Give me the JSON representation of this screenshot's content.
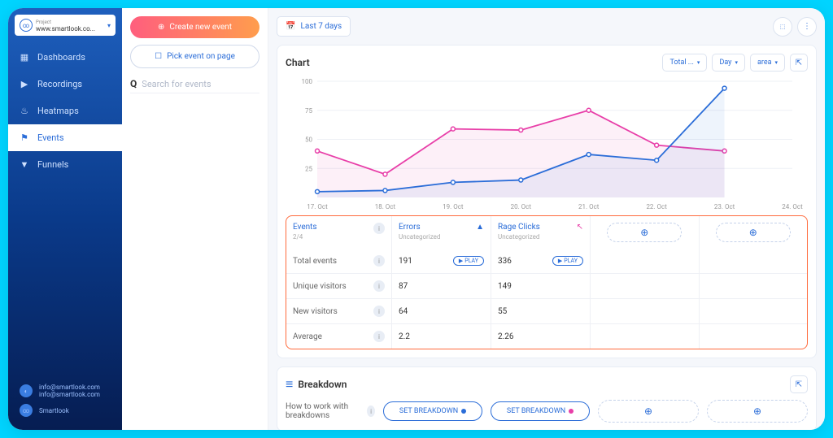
{
  "project": {
    "label": "Project",
    "value": "www.smartlook.co..."
  },
  "nav": [
    {
      "label": "Dashboards"
    },
    {
      "label": "Recordings"
    },
    {
      "label": "Heatmaps"
    },
    {
      "label": "Events"
    },
    {
      "label": "Funnels"
    }
  ],
  "user": {
    "email1": "info@smartlook.com",
    "email2": "info@smartlook.com",
    "brand": "Smartlook"
  },
  "panel2": {
    "create": "Create new event",
    "pick": "Pick event on page",
    "search_ph": "Search for events"
  },
  "topbar": {
    "range": "Last 7 days"
  },
  "chart": {
    "title": "Chart",
    "filters": {
      "metric": "Total ...",
      "granularity": "Day",
      "style": "area"
    }
  },
  "chart_data": {
    "type": "line",
    "x": [
      "17. Oct",
      "18. Oct",
      "19. Oct",
      "20. Oct",
      "21. Oct",
      "22. Oct",
      "23. Oct",
      "24. Oct"
    ],
    "series": [
      {
        "name": "Errors",
        "color": "#e83ea8",
        "values": [
          40,
          20,
          59,
          58,
          75,
          45,
          40,
          null
        ]
      },
      {
        "name": "Rage Clicks",
        "color": "#2b6dd8",
        "values": [
          5,
          6,
          13,
          15,
          37,
          32,
          94,
          null
        ]
      }
    ],
    "ylabel": "",
    "xlabel": "",
    "ylim": [
      0,
      100
    ],
    "yticks": [
      25,
      50,
      75,
      100
    ]
  },
  "stats": {
    "head": {
      "label": "Events",
      "sub": "2/4"
    },
    "cols": [
      {
        "name": "Errors",
        "sub": "Uncategorized",
        "color": "blue"
      },
      {
        "name": "Rage Clicks",
        "sub": "Uncategorized",
        "color": "pink"
      }
    ],
    "rows": [
      {
        "label": "Total events",
        "vals": [
          "191",
          "336"
        ],
        "play": true
      },
      {
        "label": "Unique visitors",
        "vals": [
          "87",
          "149"
        ]
      },
      {
        "label": "New visitors",
        "vals": [
          "64",
          "55"
        ]
      },
      {
        "label": "Average",
        "vals": [
          "2.2",
          "2.26"
        ]
      }
    ],
    "play": "PLAY"
  },
  "breakdown": {
    "title": "Breakdown",
    "label": "How to work with breakdowns",
    "set": "SET BREAKDOWN"
  }
}
